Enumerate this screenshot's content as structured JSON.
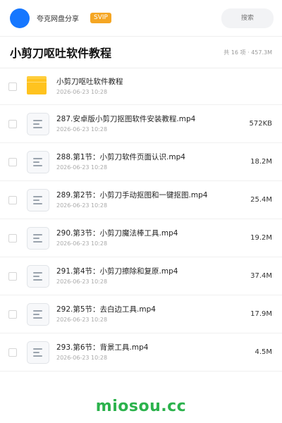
{
  "account": {
    "name": "夸克网盘分享",
    "badge": "SVIP"
  },
  "search": {
    "placeholder": "搜索"
  },
  "folder": {
    "title": "小剪刀呕吐软件教程",
    "summary": "共 16 项 · 457.3M"
  },
  "items": [
    {
      "type": "folder",
      "name": "小剪刀呕吐软件教程",
      "date": "2026-06-23 10:28",
      "size": ""
    },
    {
      "type": "file",
      "name": "287.安卓版小剪刀抠图软件安装教程.mp4",
      "date": "2026-06-23 10:28",
      "size": "572KB"
    },
    {
      "type": "file",
      "name": "288.第1节：小剪刀软件页面认识.mp4",
      "date": "2026-06-23 10:28",
      "size": "18.2M"
    },
    {
      "type": "file",
      "name": "289.第2节：小剪刀手动抠图和一键抠图.mp4",
      "date": "2026-06-23 10:28",
      "size": "25.4M"
    },
    {
      "type": "file",
      "name": "290.第3节：小剪刀魔法棒工具.mp4",
      "date": "2026-06-23 10:28",
      "size": "19.2M"
    },
    {
      "type": "file",
      "name": "291.第4节：小剪刀擦除和复原.mp4",
      "date": "2026-06-23 10:28",
      "size": "37.4M"
    },
    {
      "type": "file",
      "name": "292.第5节：去白边工具.mp4",
      "date": "2026-06-23 10:28",
      "size": "17.9M"
    },
    {
      "type": "file",
      "name": "293.第6节：背景工具.mp4",
      "date": "2026-06-23 10:28",
      "size": "4.5M"
    }
  ],
  "watermark": "miosou.cc",
  "colors": {
    "accent": "#1677ff",
    "svip": "#f5a623",
    "folder": "#ffc31f",
    "watermark": "#2bb24c"
  }
}
